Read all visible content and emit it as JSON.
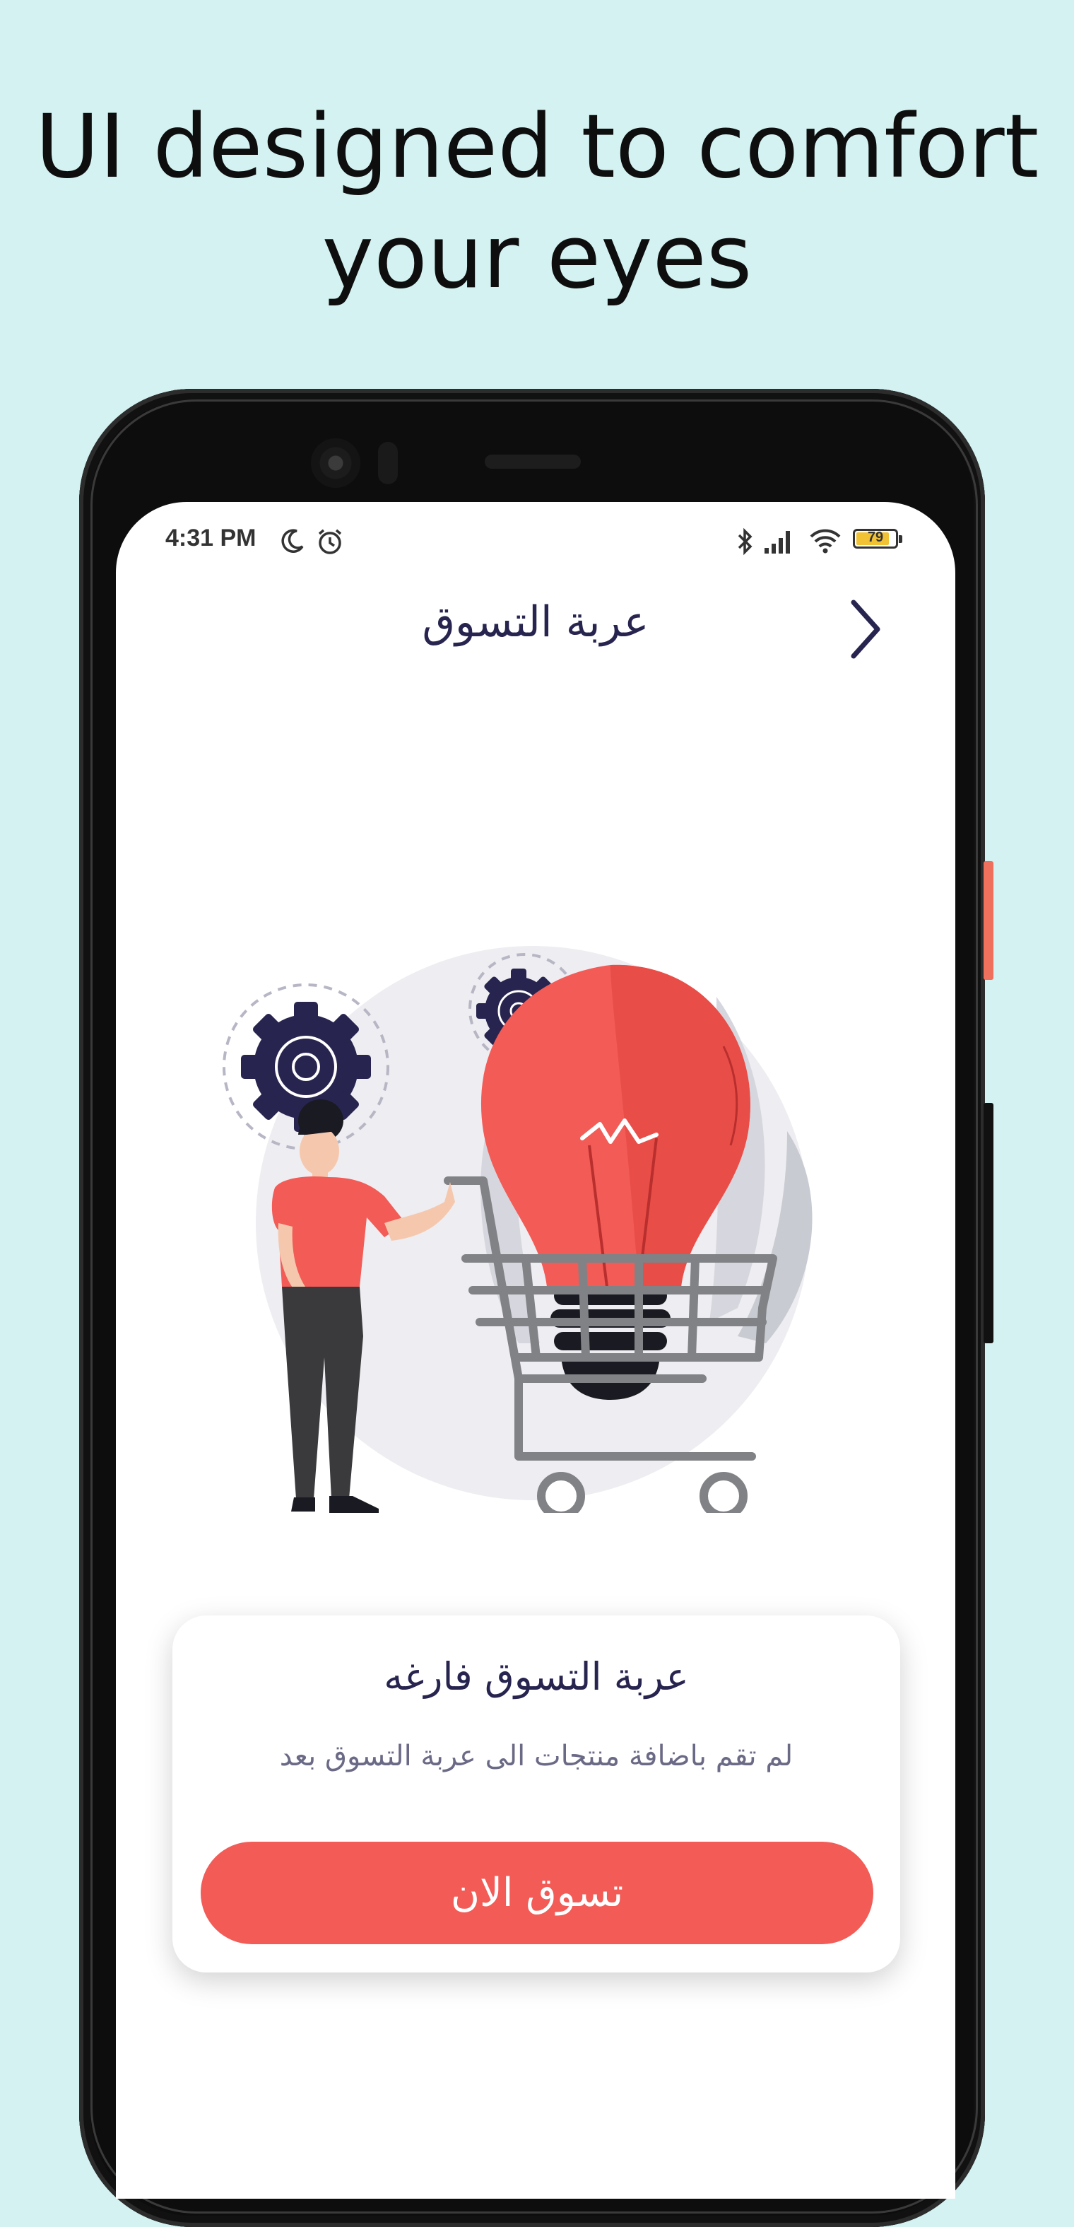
{
  "headline": {
    "line1": "UI designed to comfort",
    "line2": "your eyes"
  },
  "status_bar": {
    "time": "4:31 PM",
    "battery": "79",
    "icons": [
      "moon-icon",
      "alarm-icon",
      "bluetooth-icon",
      "signal-icon",
      "wifi-icon",
      "battery-icon"
    ]
  },
  "header": {
    "title": "عربة التسوق",
    "back_icon": "chevron-right-icon"
  },
  "empty_cart": {
    "title": "عربة التسوق فارغه",
    "message": "لم تقم باضافة منتجات الى عربة التسوق بعد",
    "button_label": "تسوق الان"
  },
  "colors": {
    "background": "#d3f2f1",
    "accent": "#f25b56",
    "navy": "#27254f",
    "bulb": "#f25b56",
    "muted_text": "#6b6a86"
  }
}
